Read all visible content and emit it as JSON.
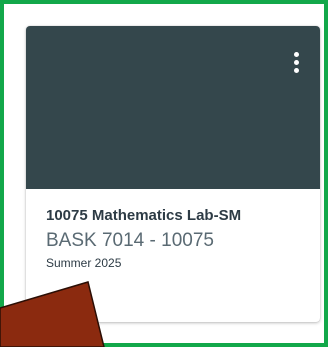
{
  "course_card": {
    "title": "10075 Mathematics Lab-SM",
    "code": "BASK 7014 - 10075",
    "term": "Summer 2025",
    "header_color": "#34474c",
    "menu_icon": "kebab-vertical-icon"
  },
  "highlight": {
    "border_color": "#12a84a"
  },
  "overlay": {
    "color": "#8b2a0f",
    "border_color": "#2b0e05"
  }
}
